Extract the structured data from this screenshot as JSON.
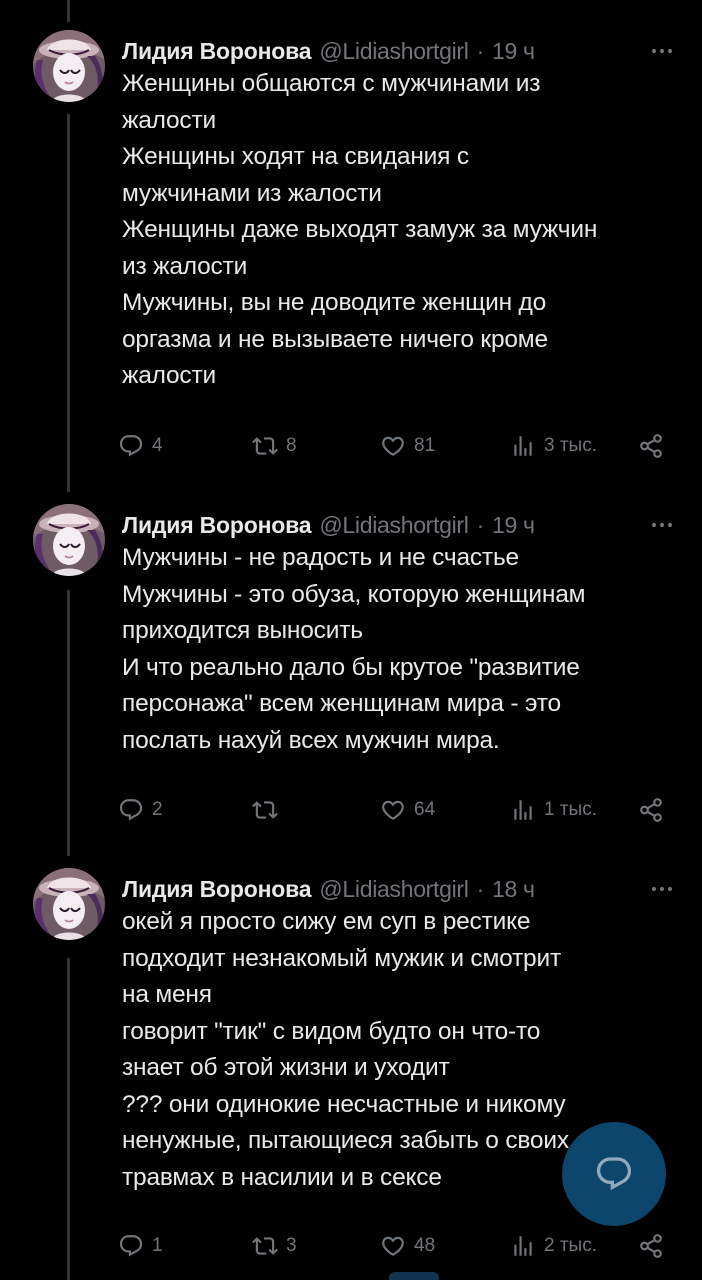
{
  "colors": {
    "background": "#000000",
    "text": "#e7e9ea",
    "secondary": "#71767b",
    "thread_line": "#333639",
    "accent": "#1d9bf0"
  },
  "tweets": [
    {
      "author_name": "Лидия Воронова",
      "handle": "@Lidiashortgirl",
      "separator": "·",
      "time": "19 ч",
      "lines": [
        "Женщины общаются с мужчинами из",
        "жалости",
        "Женщины ходят на свидания с",
        "мужчинами из жалости",
        "Женщины даже выходят замуж за мужчин",
        "из жалости",
        "Мужчины, вы не доводите женщин до",
        "оргазма и не вызываете ничего кроме",
        "жалости"
      ],
      "replies": "4",
      "reposts": "8",
      "likes": "81",
      "views": "3 тыс."
    },
    {
      "author_name": "Лидия Воронова",
      "handle": "@Lidiashortgirl",
      "separator": "·",
      "time": "19 ч",
      "lines": [
        "Мужчины - не радость и не счастье",
        "Мужчины - это обуза, которую женщинам",
        "приходится выносить",
        "И что реально дало бы крутое \"развитие",
        "персонажа\" всем женщинам мира - это",
        "послать нахуй всех мужчин мира."
      ],
      "replies": "2",
      "reposts": "",
      "likes": "64",
      "views": "1 тыс."
    },
    {
      "author_name": "Лидия Воронова",
      "handle": "@Lidiashortgirl",
      "separator": "·",
      "time": "18 ч",
      "lines": [
        "окей я просто сижу ем суп в рестике",
        "подходит незнакомый мужик и смотрит",
        "на меня",
        "говорит \"тик\" с видом будто он что-то",
        "знает об этой жизни и уходит",
        "??? они одинокие несчастные и никому",
        "ненужные, пытающиеся забыть о своих",
        "травмах в насилии и в сексе"
      ],
      "replies": "1",
      "reposts": "3",
      "likes": "48",
      "views": "2 тыс."
    }
  ],
  "fab": {
    "icon": "compose-reply-icon"
  }
}
